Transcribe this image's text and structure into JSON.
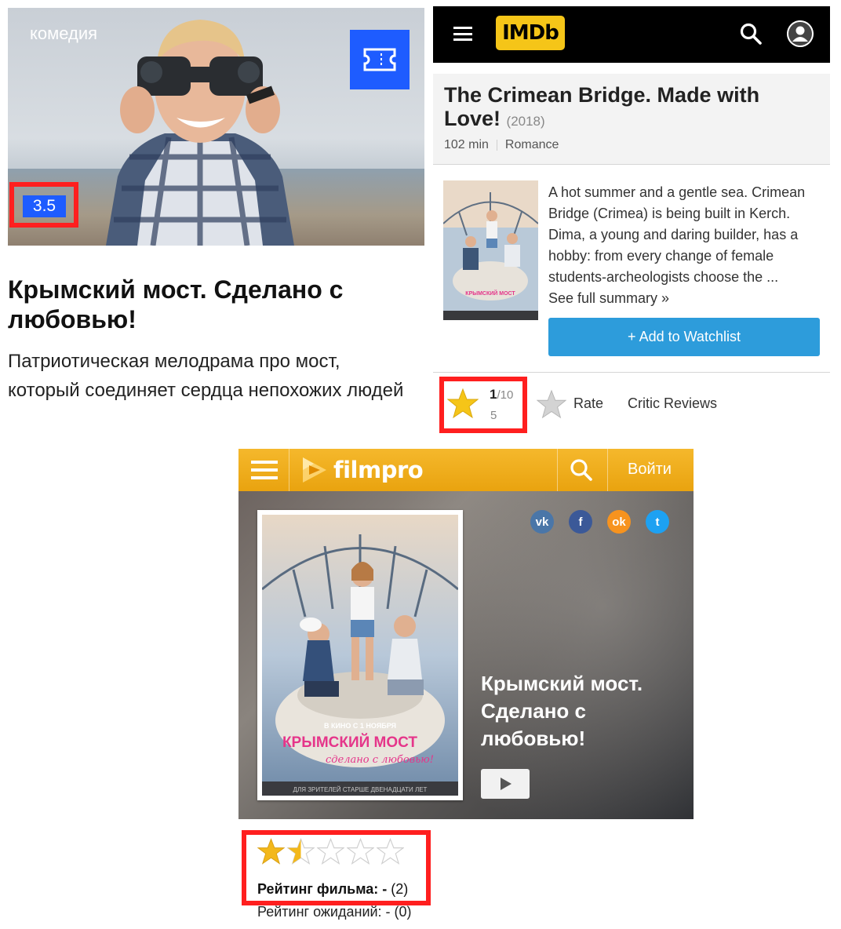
{
  "panel1": {
    "genre": "комедия",
    "rating": "3.5",
    "title": "Крымский мост. Сделано с любовью!",
    "description": "Патриотическая мелодрама про мост, который соединяет сердца непохожих людей",
    "ticket_icon": "ticket-icon",
    "accent_color": "#1e5cff",
    "highlight_color": "#ff1f1f"
  },
  "imdb": {
    "logo": "IMDb",
    "logo_color": "#f5c518",
    "menu_icon": "hamburger-icon",
    "search_icon": "search-icon",
    "account_icon": "user-icon",
    "title": "The Crimean Bridge. Made with Love!",
    "year": "(2018)",
    "runtime": "102 min",
    "genre": "Romance",
    "summary": "A hot summer and a gentle sea. Crimean Bridge (Crimea) is being built in Kerch. Dima, a young and daring builder, has a hobby: from every change of female students-archeologists choose the ...",
    "see_full": "See full summary »",
    "watchlist_label": "+ Add to Watchlist",
    "watchlist_color": "#2d9cdb",
    "score": "1",
    "score_max": "/10",
    "votes": "5",
    "rate_label": "Rate",
    "critic_reviews_label": "Critic Reviews"
  },
  "filmpro": {
    "logo_text": "filmpro",
    "login_label": "Войти",
    "bar_color": "#f0ae1c",
    "hero_title": "Крымский мост. Сделано с любовью!",
    "poster_text_top": "В КИНО С 1 НОЯБРЯ",
    "poster_title": "КРЫМСКИЙ МОСТ",
    "poster_subtitle": "сделано с любовью!",
    "poster_footer": "ДЛЯ ЗРИТЕЛЕЙ СТАРШЕ ДВЕНАДЦАТИ ЛЕТ",
    "social": [
      {
        "icon": "vk-icon",
        "glyph": "vk",
        "color": "#4a76a8"
      },
      {
        "icon": "facebook-icon",
        "glyph": "f",
        "color": "#3b5998"
      },
      {
        "icon": "odnoklassniki-icon",
        "glyph": "ok",
        "color": "#f7931e"
      },
      {
        "icon": "twitter-icon",
        "glyph": "t",
        "color": "#1da1f2"
      }
    ],
    "stars_filled": 1.5,
    "stars_total": 5,
    "rating_label": "Рейтинг фильма: -",
    "rating_count": " (2)",
    "expect_label": "Рейтинг ожиданий: - (0)"
  }
}
